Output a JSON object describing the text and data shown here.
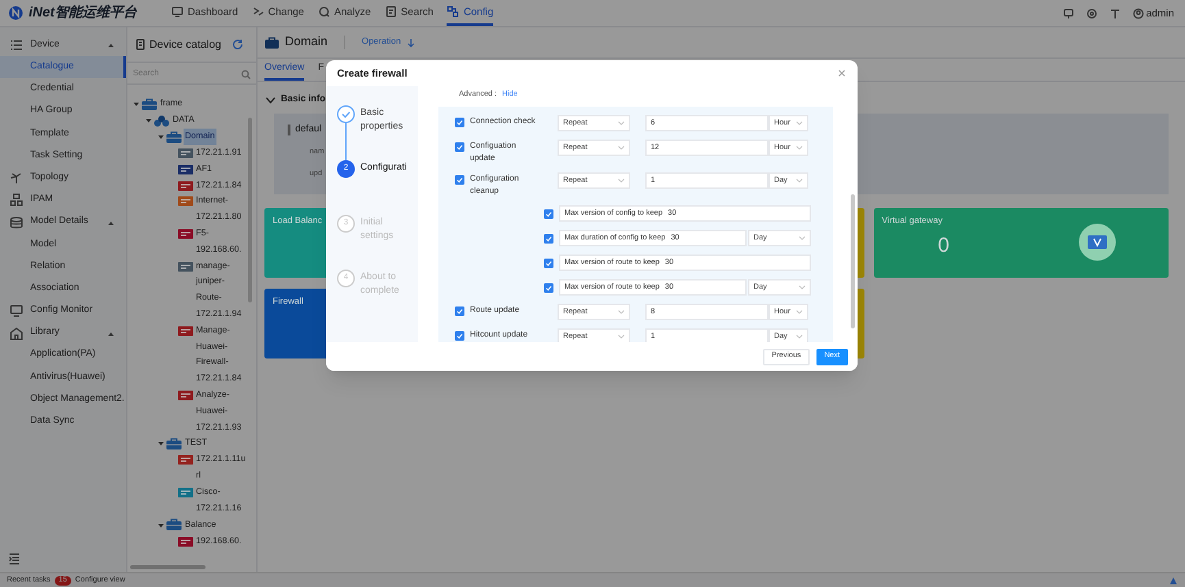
{
  "header": {
    "logo_text": "iNet智能运维平台",
    "nav": [
      {
        "label": "Dashboard",
        "selected": false
      },
      {
        "label": "Change",
        "selected": false
      },
      {
        "label": "Analyze",
        "selected": false
      },
      {
        "label": "Search",
        "selected": false
      },
      {
        "label": "Config",
        "selected": true
      }
    ],
    "user": "admin"
  },
  "sidebar": {
    "items": [
      {
        "label": "Device",
        "expanded": true,
        "children": [
          {
            "label": "Catalogue",
            "selected": true
          },
          {
            "label": "Credential",
            "selected": false
          },
          {
            "label": "HA Group",
            "selected": false
          },
          {
            "label": "Template",
            "selected": false
          },
          {
            "label": "Task Setting",
            "selected": false
          }
        ]
      },
      {
        "label": "Topology",
        "selected": false
      },
      {
        "label": "IPAM",
        "selected": false
      },
      {
        "label": "Model Details",
        "expanded": true,
        "children": [
          {
            "label": "Model",
            "selected": false
          },
          {
            "label": "Relation",
            "selected": false
          },
          {
            "label": "Association",
            "selected": false
          }
        ]
      },
      {
        "label": "Config Monitor",
        "selected": false
      },
      {
        "label": "Library",
        "expanded": true,
        "children": [
          {
            "label": "Application(PA)",
            "selected": false
          },
          {
            "label": "Antivirus(Huawei)",
            "selected": false
          },
          {
            "label": "Object Management2.",
            "selected": false
          },
          {
            "label": "Data Sync",
            "selected": false
          }
        ]
      }
    ]
  },
  "catalog": {
    "title": "Device catalog",
    "search_placeholder": "Search",
    "tree": [
      {
        "kind": "group",
        "label": "frame",
        "expanded": true,
        "selected": false,
        "children": [
          {
            "kind": "datacenter",
            "label": "DATA",
            "expanded": true,
            "selected": false,
            "children": [
              {
                "kind": "group",
                "label": "Domain",
                "expanded": true,
                "selected": true,
                "children": [
                  {
                    "kind": "device",
                    "label": "172.21.1.91",
                    "color": "#44525e",
                    "selected": false
                  },
                  {
                    "kind": "device",
                    "label": "AF1",
                    "color": "#1a2d66",
                    "selected": false
                  },
                  {
                    "kind": "device",
                    "label": "172.21.1.84",
                    "color": "#8e1a1e",
                    "selected": false
                  },
                  {
                    "kind": "device",
                    "label": "Internet-172.21.1.80",
                    "color": "#a04a1a",
                    "selected": false
                  },
                  {
                    "kind": "device",
                    "label": "F5-192.168.60.",
                    "color": "#8a0c26",
                    "selected": false
                  },
                  {
                    "kind": "device",
                    "label": "manage-juniper-Route-172.21.1.94",
                    "color": "#44525e",
                    "selected": false
                  },
                  {
                    "kind": "device",
                    "label": "Manage-Huawei-Firewall-172.21.1.84",
                    "color": "#8e1a1e",
                    "selected": false
                  },
                  {
                    "kind": "device",
                    "label": "Analyze-Huawei-172.21.1.93",
                    "color": "#8e1a1e",
                    "selected": false
                  }
                ]
              },
              {
                "kind": "group",
                "label": "TEST",
                "expanded": true,
                "selected": false,
                "children": [
                  {
                    "kind": "device",
                    "label": "172.21.1.11url",
                    "color": "#94221e",
                    "selected": false
                  },
                  {
                    "kind": "device",
                    "label": "Cisco-172.21.1.16",
                    "color": "#127088",
                    "selected": false
                  }
                ]
              },
              {
                "kind": "group",
                "label": "Balance",
                "expanded": true,
                "selected": false,
                "children": [
                  {
                    "kind": "device",
                    "label": "192.168.60.",
                    "color": "#8a0c26",
                    "selected": false
                  }
                ]
              }
            ]
          }
        ]
      }
    ]
  },
  "main": {
    "title": "Domain",
    "operation": "Operation",
    "tabs": [
      {
        "label": "Overview",
        "selected": true
      },
      {
        "label": "F",
        "selected": false
      }
    ],
    "basic_info": {
      "title": "Basic info",
      "expanded": true,
      "name": "defaul",
      "fields": [
        "nam",
        "upd"
      ]
    },
    "cards": [
      {
        "label": "Load Balanc",
        "color": "#158c80"
      },
      {
        "color": "#9c8606"
      },
      {
        "label": "Virtual gateway",
        "count": "0",
        "color": "#1b8a62"
      },
      {
        "label": "Firewall",
        "color": "#0a4a9a"
      },
      {
        "color": "#9c8606"
      }
    ]
  },
  "dialog": {
    "title": "Create firewall",
    "steps": [
      {
        "label": "Basic properties",
        "completed": true,
        "selected": false
      },
      {
        "label": "Configurati",
        "completed": false,
        "selected": true,
        "number": "2"
      },
      {
        "label": "Initial settings",
        "completed": false,
        "selected": false,
        "number": "3"
      },
      {
        "label": "About to complete",
        "completed": false,
        "selected": false,
        "number": "4"
      }
    ],
    "advanced_label": "Advanced :",
    "advanced_toggle": "Hide",
    "rows": [
      {
        "kind": "schedule",
        "label": "Connection check",
        "checked": true,
        "mode": "Repeat",
        "value": "6",
        "unit": "Hour"
      },
      {
        "kind": "schedule",
        "label": "Configuation update",
        "checked": true,
        "mode": "Repeat",
        "value": "12",
        "unit": "Hour"
      },
      {
        "kind": "schedule",
        "label": "Configuration cleanup",
        "checked": true,
        "mode": "Repeat",
        "value": "1",
        "unit": "Day"
      },
      {
        "kind": "retention",
        "label": "Max version of config to keep",
        "checked": true,
        "value": "30"
      },
      {
        "kind": "retention",
        "label": "Max duration of config to keep",
        "checked": true,
        "value": "30",
        "unit": "Day"
      },
      {
        "kind": "retention",
        "label": "Max version of route to keep",
        "checked": true,
        "value": "30"
      },
      {
        "kind": "retention",
        "label": "Max version of route to keep",
        "checked": true,
        "value": "30",
        "unit": "Day"
      },
      {
        "kind": "schedule",
        "label": "Route update",
        "checked": true,
        "mode": "Repeat",
        "value": "8",
        "unit": "Hour"
      },
      {
        "kind": "schedule",
        "label": "Hitcount update",
        "checked": true,
        "mode": "Repeat",
        "value": "1",
        "unit": "Day"
      }
    ],
    "buttons": [
      {
        "label": "Previous",
        "kind": "secondary"
      },
      {
        "label": "Next",
        "kind": "primary"
      }
    ]
  },
  "status_bar": {
    "recent_tasks": "Recent tasks",
    "count": "15",
    "configure": "Configure view"
  }
}
